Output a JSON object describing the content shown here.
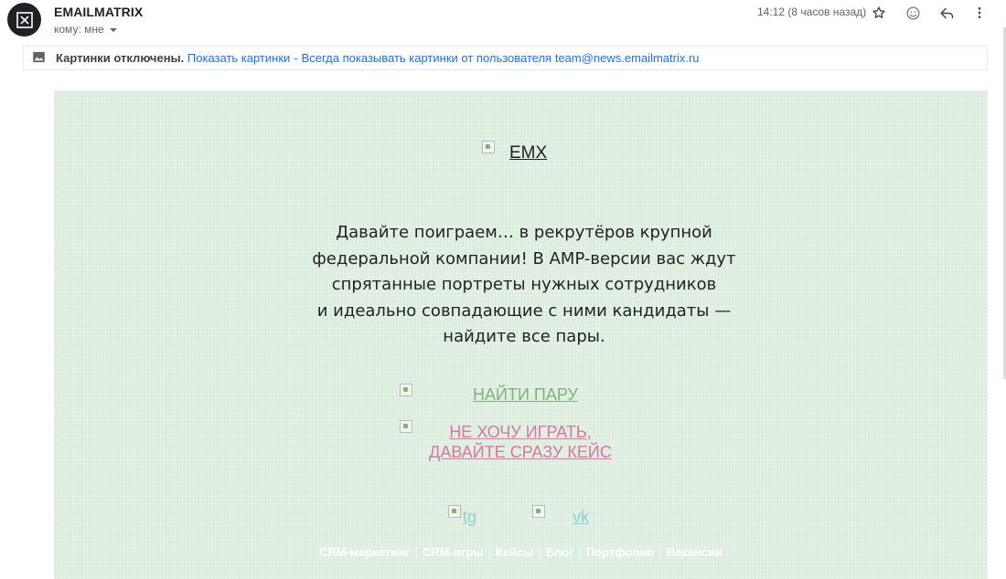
{
  "header": {
    "sender": "EMAILMATRIX",
    "recipient": "кому: мне",
    "time": "14:12 (8 часов назад)"
  },
  "images_bar": {
    "disabled_text": "Картинки отключены.",
    "show_link": "Показать картинки",
    "separator": "-",
    "always_link": "Всегда показывать картинки от пользователя team@news.emailmatrix.ru"
  },
  "email": {
    "logo_alt": "EMX",
    "intro_lines": [
      "Давайте поиграем… в рекрутёров крупной",
      "федеральной компании! В AMP-версии вас ждут",
      "спрятанные портреты нужных сотрудников",
      "и идеально совпадающие с ними кандидаты —",
      "найдите все пары."
    ],
    "cta_primary": "НАЙТИ ПАРУ",
    "cta_secondary_line1": "НЕ ХОЧУ ИГРАТЬ,",
    "cta_secondary_line2": "ДАВАЙТЕ СРАЗУ КЕЙС",
    "social": {
      "tg": "tg",
      "vk": "vk"
    },
    "footer_links": [
      "CRM-маркетинг",
      "CRM-игры",
      "Кейсы",
      "Блог",
      "Портфолио",
      "Вакансии"
    ],
    "footer_separator": "|"
  },
  "colors": {
    "email_bg": "#ddeddd",
    "cta_primary": "#7fb27a",
    "cta_secondary": "#d6779f",
    "social_link": "#8ed0d8",
    "link_blue": "#1a73e8"
  }
}
